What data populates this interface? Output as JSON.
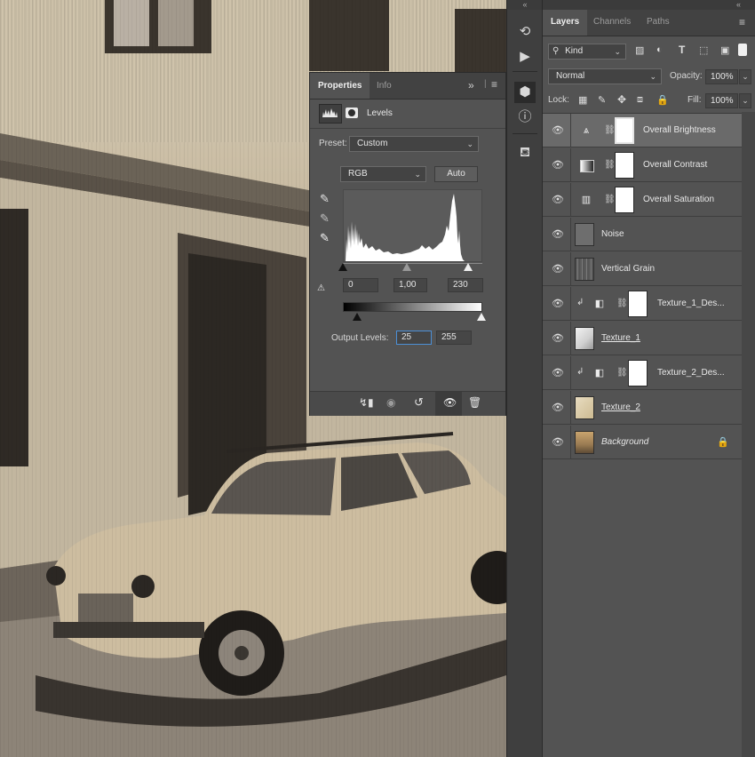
{
  "properties": {
    "tabs": [
      "Properties",
      "Info"
    ],
    "title": "Levels",
    "preset_label": "Preset:",
    "preset_value": "Custom",
    "channel_value": "RGB",
    "auto_label": "Auto",
    "input_black": "0",
    "input_gamma": "1,00",
    "input_white": "230",
    "output_label": "Output Levels:",
    "output_black": "25",
    "output_white": "255",
    "menu_glyph": "≡",
    "collapse_glyph": "»"
  },
  "strip": {
    "collapse_glyph": "«",
    "icons": [
      "history-icon",
      "play-icon",
      "properties-cube-icon",
      "info-icon",
      "clone-source-icon"
    ]
  },
  "layers_panel": {
    "collapse_glyph": "«",
    "tabs": [
      "Layers",
      "Channels",
      "Paths"
    ],
    "menu_glyph": "≡",
    "filter_kind": "Kind",
    "blend_mode": "Normal",
    "opacity_label": "Opacity:",
    "opacity_value": "100%",
    "lock_label": "Lock:",
    "fill_label": "Fill:",
    "fill_value": "100%",
    "layers": [
      {
        "name": "Overall Brightness",
        "kind": "levels",
        "selected": true
      },
      {
        "name": "Overall Contrast",
        "kind": "gradient-map"
      },
      {
        "name": "Overall Saturation",
        "kind": "hue-saturation"
      },
      {
        "name": "Noise",
        "kind": "pixel"
      },
      {
        "name": "Vertical Grain",
        "kind": "pixel"
      },
      {
        "name": "Texture_1_Des...",
        "kind": "clipped-adjustment"
      },
      {
        "name": "Texture_1",
        "kind": "smart-object"
      },
      {
        "name": "Texture_2_Des...",
        "kind": "clipped-adjustment"
      },
      {
        "name": "Texture_2",
        "kind": "smart-object"
      },
      {
        "name": "Background",
        "kind": "background",
        "locked": true
      }
    ]
  },
  "colors": {
    "panel": "#535353",
    "panel_dark": "#424242",
    "selected_row": "#6a6a6a",
    "focus": "#4c8fd6"
  }
}
